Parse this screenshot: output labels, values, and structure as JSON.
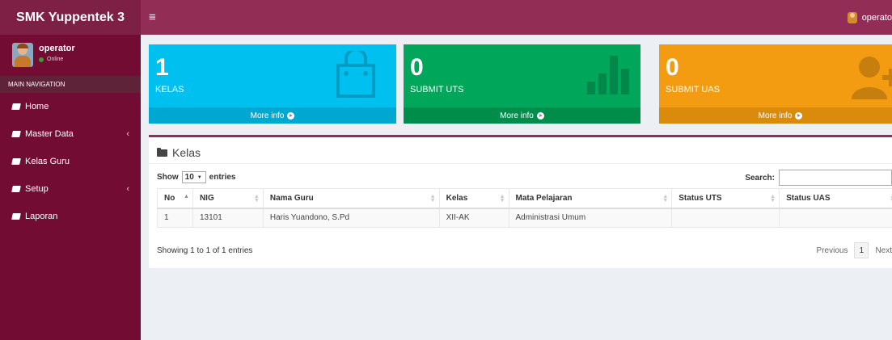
{
  "header": {
    "brand": "SMK Yuppentek 3",
    "toggle": "≡",
    "user_label": "operato"
  },
  "sidebar": {
    "user": {
      "name": "operator",
      "status": "Online"
    },
    "section_header": "MAIN NAVIGATION",
    "items": [
      {
        "label": "Home",
        "has_submenu": false
      },
      {
        "label": "Master Data",
        "has_submenu": true
      },
      {
        "label": "Kelas Guru",
        "has_submenu": false
      },
      {
        "label": "Setup",
        "has_submenu": true
      },
      {
        "label": "Laporan",
        "has_submenu": false
      }
    ],
    "submenu_chevron": "‹"
  },
  "stats": [
    {
      "number": "1",
      "label": "KELAS",
      "more": "More info",
      "color": "#00c0ef",
      "icon": "shopping-bag-icon"
    },
    {
      "number": "0",
      "label": "SUBMIT UTS",
      "more": "More info",
      "color": "#00a65a",
      "icon": "bar-chart-icon"
    },
    {
      "number": "0",
      "label": "SUBMIT UAS",
      "more": "More info",
      "color": "#f39c12",
      "icon": "user-plus-icon"
    }
  ],
  "panel": {
    "title": "Kelas",
    "show_label": "Show",
    "entries_value": "10",
    "entries_label": "entries",
    "search_label": "Search:",
    "search_value": "",
    "columns": [
      "No",
      "NIG",
      "Nama Guru",
      "Kelas",
      "Mata Pelajaran",
      "Status UTS",
      "Status UAS"
    ],
    "rows": [
      [
        "1",
        "13101",
        "Haris Yuandono, S.Pd",
        "XII-AK",
        "Administrasi Umum",
        "",
        ""
      ]
    ],
    "info": "Showing 1 to 1 of 1 entries",
    "pagination": {
      "previous": "Previous",
      "current": "1",
      "next": "Next"
    }
  },
  "colors": {
    "header": "#922d55",
    "logo": "#7e1f45",
    "sidebar": "#730c33"
  }
}
